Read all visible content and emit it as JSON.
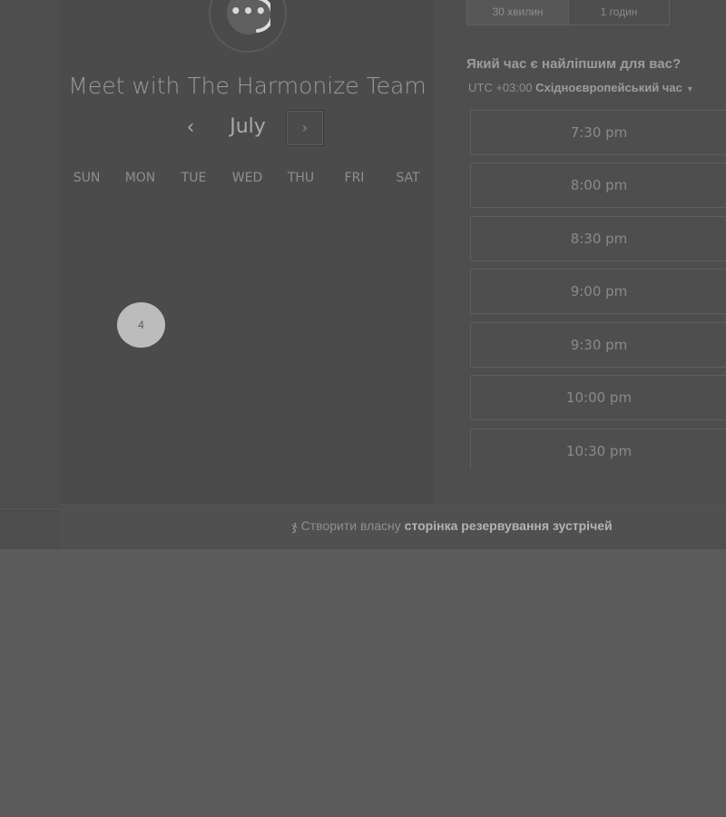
{
  "avatar": {
    "icon": "chat-bubble-icon",
    "dots": "•••"
  },
  "title": "Meet with The Harmonize Team",
  "calendar": {
    "month": "July",
    "prev_icon": "‹",
    "next_icon": "›",
    "weekdays": [
      "SUN",
      "MON",
      "TUE",
      "WED",
      "THU",
      "FRI",
      "SAT"
    ],
    "available_day": "4"
  },
  "duration": {
    "options": [
      "30 хвилин",
      "1 годин"
    ],
    "selected": "30 хвилин"
  },
  "time_question": "Який час є найліпшим для вас?",
  "timezone": {
    "offset": "UTC +03:00",
    "name": "Східноєвропейський час",
    "caret": "▼"
  },
  "slots": [
    "7:30 pm",
    "8:00 pm",
    "8:30 pm",
    "9:00 pm",
    "9:30 pm",
    "10:00 pm",
    "10:30 pm"
  ],
  "footer": {
    "icon": "hubspot-sprocket-icon",
    "sprocket": "ჯ",
    "prefix": "Створити власну",
    "link": "сторінка резервування зустрічей"
  }
}
